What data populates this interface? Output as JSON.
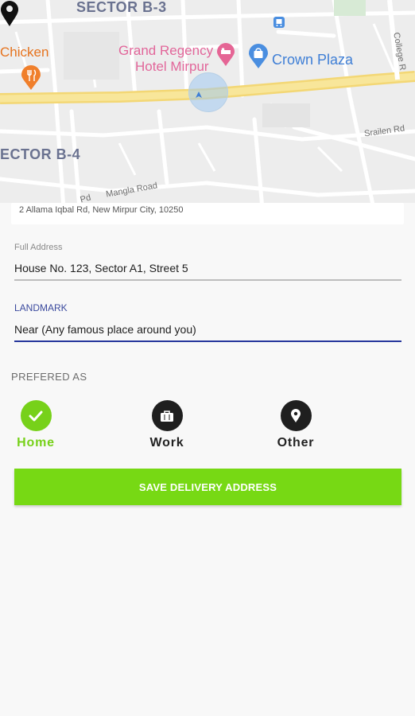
{
  "map": {
    "area_labels": [
      "SECTOR B-3",
      "ECTOR B-4"
    ],
    "pois": {
      "chicken": "Chicken",
      "grand_regency_line1": "Grand Regency",
      "grand_regency_line2": "Hotel Mirpur",
      "crown_plaza": "Crown Plaza"
    },
    "road_labels": {
      "srailen": "Srailen Rd",
      "mangla": "Mangla Road",
      "college": "College R",
      "pd": "Pd"
    },
    "colors": {
      "main_road": "#f5e07a",
      "background": "#ededed",
      "minor_road": "#ffffff"
    }
  },
  "address_summary": "2 Allama Iqbal Rd, New Mirpur City, 10250",
  "full_address": {
    "label": "Full Address",
    "value": "House No. 123, Sector A1, Street 5"
  },
  "landmark": {
    "label": "LANDMARK",
    "value": "Near (Any famous place around you)"
  },
  "preferred_as": {
    "label": "PREFERED AS",
    "options": [
      {
        "label": "Home",
        "icon": "check-icon",
        "selected": true
      },
      {
        "label": "Work",
        "icon": "briefcase-icon",
        "selected": false
      },
      {
        "label": "Other",
        "icon": "location-pin-icon",
        "selected": false
      }
    ]
  },
  "save_button": "SAVE DELIVERY ADDRESS",
  "colors": {
    "accent_green": "#77d914",
    "indigo": "#26379c",
    "dark": "#1f1f1f"
  }
}
